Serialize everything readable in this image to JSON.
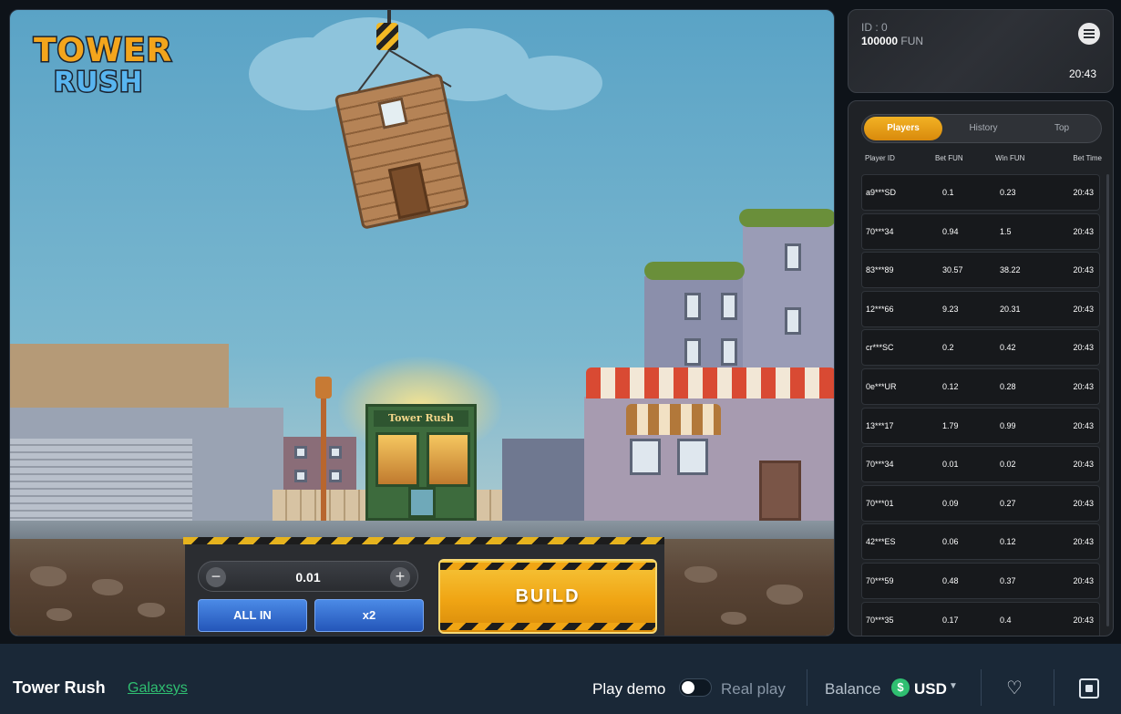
{
  "game": {
    "logo_line1": "TOWER",
    "logo_line2": "RUSH",
    "shop_sign": "Tower Rush",
    "stake_value": "0.01",
    "minus_symbol": "−",
    "plus_symbol": "+",
    "all_in_label": "ALL IN",
    "x2_label": "x2",
    "build_label": "BUILD"
  },
  "account": {
    "id_label": "ID : 0",
    "balance_amount": "100000",
    "balance_currency": "FUN",
    "time": "20:43"
  },
  "bets_panel": {
    "tabs": [
      {
        "label": "Players",
        "active": true
      },
      {
        "label": "History",
        "active": false
      },
      {
        "label": "Top",
        "active": false
      }
    ],
    "columns": [
      "Player ID",
      "Bet  FUN",
      "Win  FUN",
      "Bet Time"
    ],
    "rows": [
      {
        "player": "a9***SD",
        "bet": "0.1",
        "win": "0.23",
        "time": "20:43"
      },
      {
        "player": "70***34",
        "bet": "0.94",
        "win": "1.5",
        "time": "20:43"
      },
      {
        "player": "83***89",
        "bet": "30.57",
        "win": "38.22",
        "time": "20:43"
      },
      {
        "player": "12***66",
        "bet": "9.23",
        "win": "20.31",
        "time": "20:43"
      },
      {
        "player": "cr***SC",
        "bet": "0.2",
        "win": "0.42",
        "time": "20:43"
      },
      {
        "player": "0e***UR",
        "bet": "0.12",
        "win": "0.28",
        "time": "20:43"
      },
      {
        "player": "13***17",
        "bet": "1.79",
        "win": "0.99",
        "time": "20:43"
      },
      {
        "player": "70***34",
        "bet": "0.01",
        "win": "0.02",
        "time": "20:43"
      },
      {
        "player": "70***01",
        "bet": "0.09",
        "win": "0.27",
        "time": "20:43"
      },
      {
        "player": "42***ES",
        "bet": "0.06",
        "win": "0.12",
        "time": "20:43"
      },
      {
        "player": "70***59",
        "bet": "0.48",
        "win": "0.37",
        "time": "20:43"
      },
      {
        "player": "70***35",
        "bet": "0.17",
        "win": "0.4",
        "time": "20:43"
      }
    ]
  },
  "footer": {
    "game_title": "Tower Rush",
    "provider": "Galaxsys",
    "play_demo": "Play demo",
    "real_play": "Real play",
    "balance_label": "Balance",
    "coin_symbol": "$",
    "currency": "USD"
  },
  "colors": {
    "accent": "#f0a514",
    "provider_green": "#2fbf71",
    "footer_bg": "#1a2837"
  },
  "icons": [
    "menu-icon",
    "heart-icon",
    "fullscreen-icon",
    "dollar-coin-icon",
    "chevron-down-icon",
    "crane-hook-icon"
  ]
}
